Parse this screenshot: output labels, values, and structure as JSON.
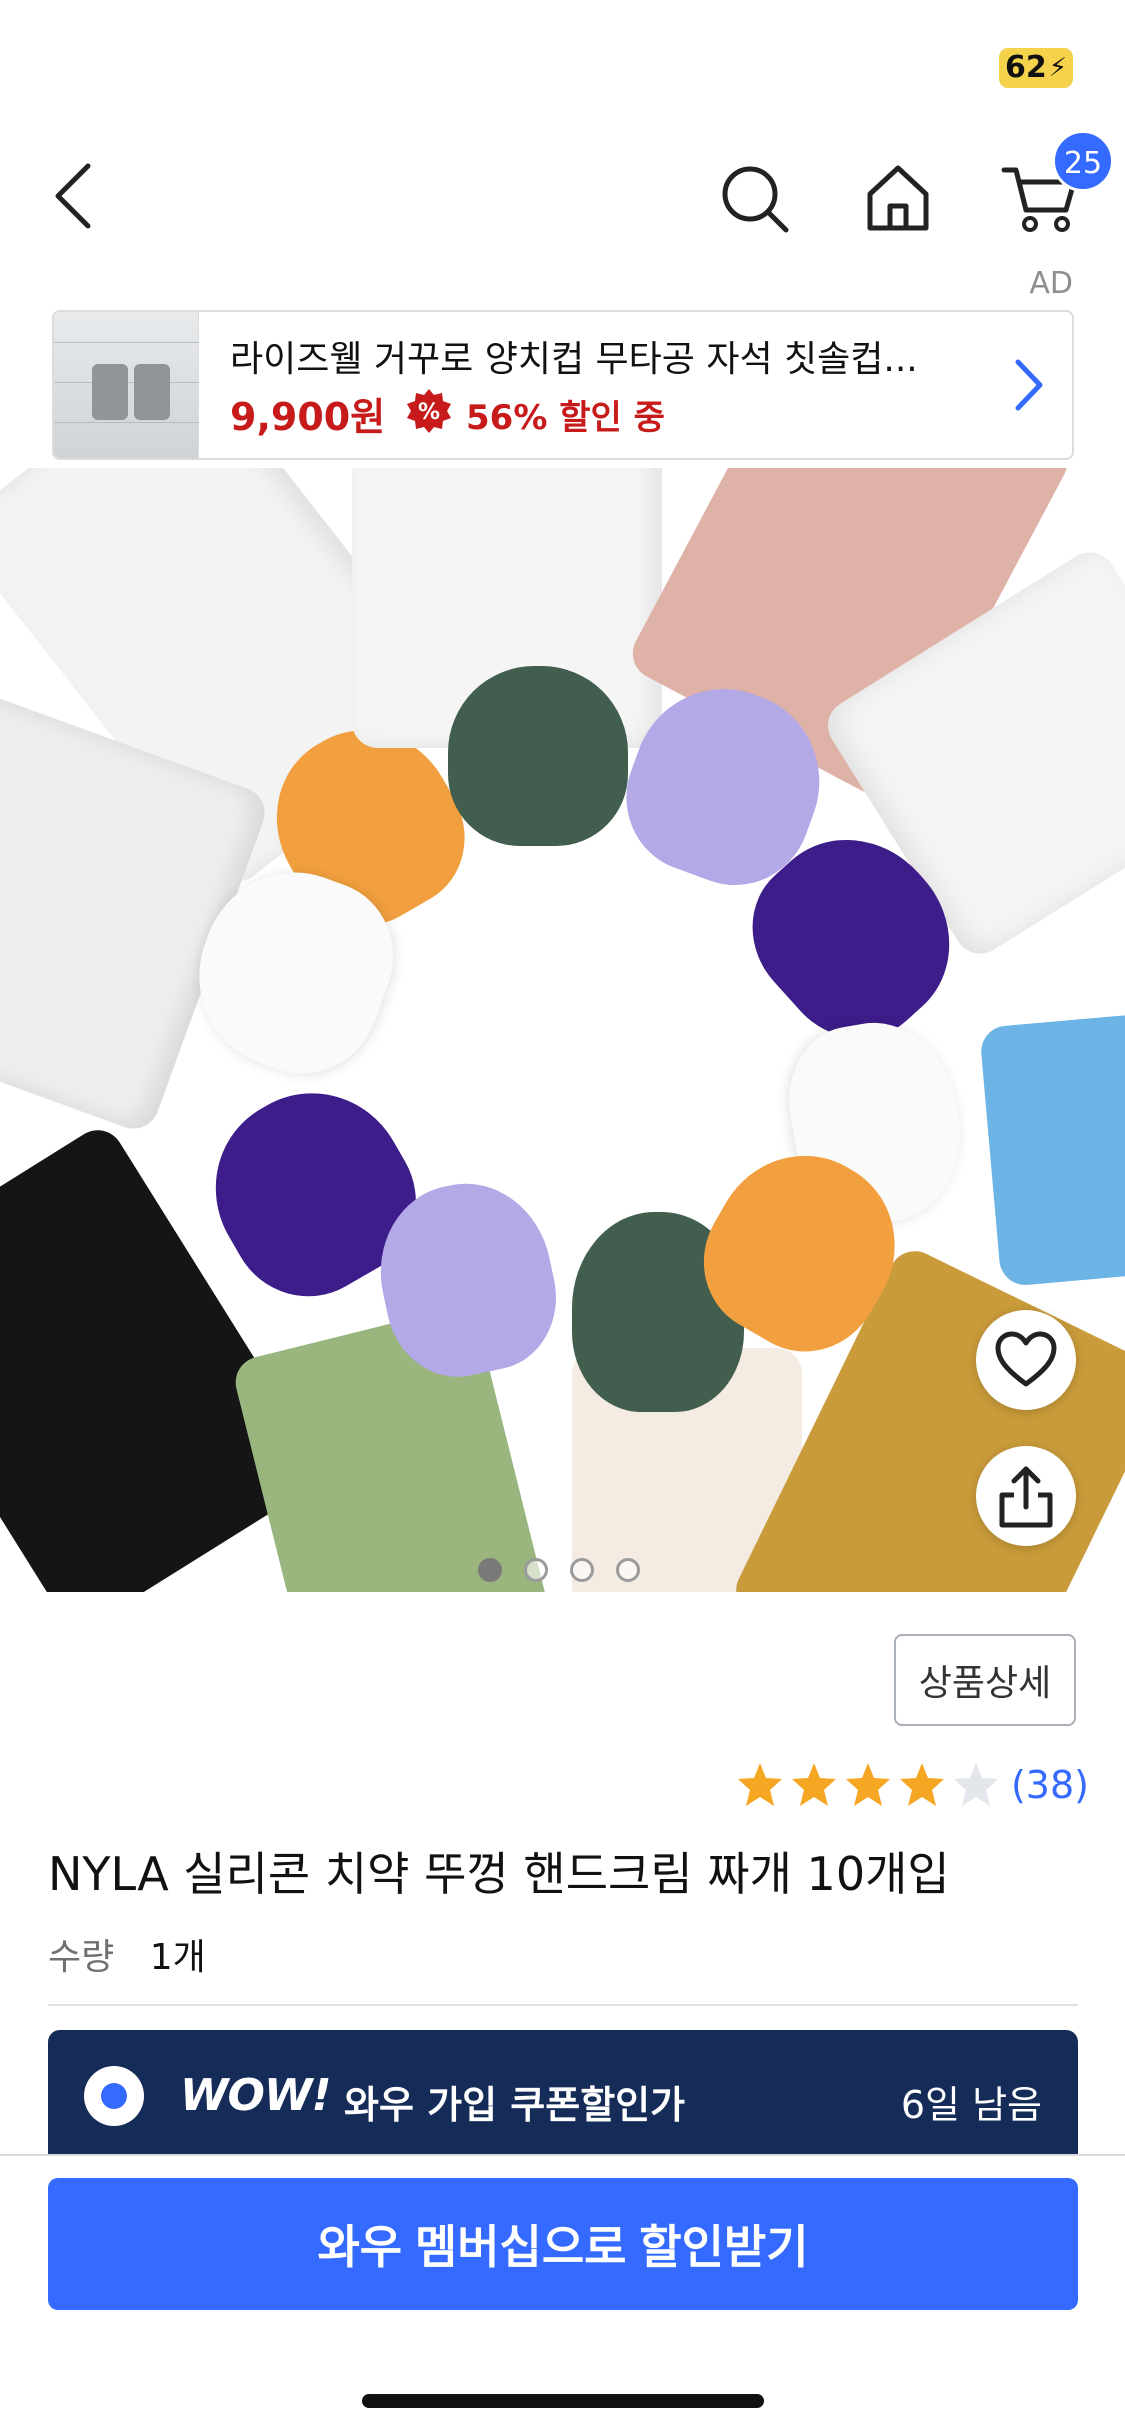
{
  "status_bar": {
    "battery_level": "62"
  },
  "header": {
    "cart_count": "25"
  },
  "ad": {
    "label": "AD",
    "title": "라이즈웰 거꾸로 양치컵 무타공 자석 칫솔컵...",
    "price": "9,900원",
    "discount": "56% 할인 중",
    "discount_icon": "%"
  },
  "gallery": {
    "slide_count": 4,
    "active_slide": 1
  },
  "product": {
    "detail_button": "상품상세",
    "rating": 4,
    "rating_max": 5,
    "review_count": "(38)",
    "title": "NYLA 실리콘 치약 뚜껑 핸드크림 짜개 10개입",
    "quantity_label": "수량",
    "quantity_value": "1개"
  },
  "wow": {
    "logo": "WOW!",
    "text": "와우 가입 쿠폰할인가",
    "days_left": "6일 남음"
  },
  "cta": {
    "label": "와우 멤버십으로 할인받기"
  },
  "colors": {
    "accent": "#346aff",
    "price_red": "#c71b1b",
    "wow_navy": "#162c58",
    "star": "#f5a623"
  }
}
